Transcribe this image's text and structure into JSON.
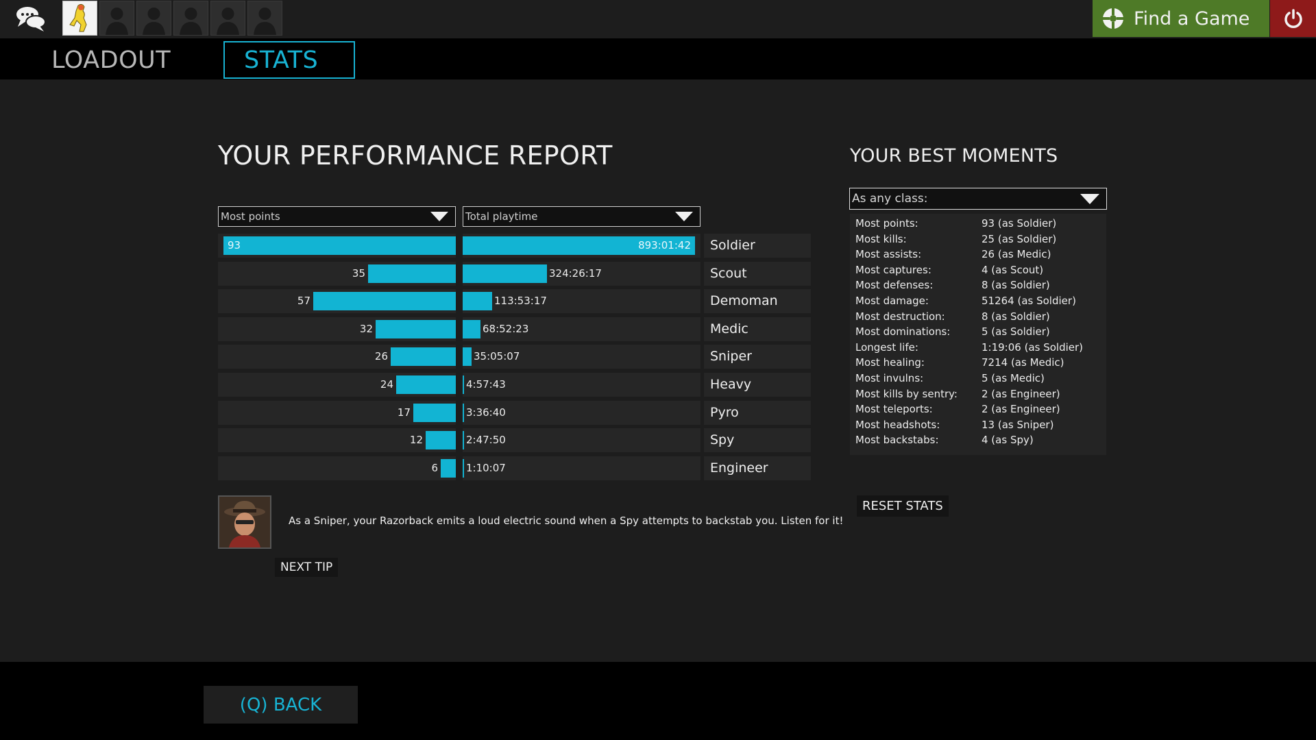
{
  "topbar": {
    "find_game_label": "Find a Game"
  },
  "tabs": [
    {
      "label": "LOADOUT"
    },
    {
      "label": "STATS"
    }
  ],
  "report": {
    "title": "YOUR PERFORMANCE REPORT",
    "left_dropdown": "Most points",
    "right_dropdown": "Total playtime",
    "rows": [
      {
        "class": "Soldier",
        "points": "93",
        "playtime": "893:01:42",
        "points_value": 93,
        "playtime_hours": 893.03
      },
      {
        "class": "Scout",
        "points": "35",
        "playtime": "324:26:17",
        "points_value": 35,
        "playtime_hours": 324.44
      },
      {
        "class": "Demoman",
        "points": "57",
        "playtime": "113:53:17",
        "points_value": 57,
        "playtime_hours": 113.89
      },
      {
        "class": "Medic",
        "points": "32",
        "playtime": "68:52:23",
        "points_value": 32,
        "playtime_hours": 68.87
      },
      {
        "class": "Sniper",
        "points": "26",
        "playtime": "35:05:07",
        "points_value": 26,
        "playtime_hours": 35.09
      },
      {
        "class": "Heavy",
        "points": "24",
        "playtime": "4:57:43",
        "points_value": 24,
        "playtime_hours": 4.96
      },
      {
        "class": "Pyro",
        "points": "17",
        "playtime": "3:36:40",
        "points_value": 17,
        "playtime_hours": 3.61
      },
      {
        "class": "Spy",
        "points": "12",
        "playtime": "2:47:50",
        "points_value": 12,
        "playtime_hours": 2.8
      },
      {
        "class": "Engineer",
        "points": "6",
        "playtime": "1:10:07",
        "points_value": 6,
        "playtime_hours": 1.17
      }
    ],
    "points_max": 93,
    "playtime_max_hours": 893.03
  },
  "tip": {
    "text": "As a Sniper, your Razorback emits a loud electric sound when a Spy attempts to backstab you. Listen for it!",
    "next_label": "NEXT TIP"
  },
  "best": {
    "title": "YOUR BEST MOMENTS",
    "dropdown": "As any class:",
    "items": [
      {
        "label": "Most points:",
        "value": "93 (as Soldier)"
      },
      {
        "label": "Most kills:",
        "value": "25 (as Soldier)"
      },
      {
        "label": "Most assists:",
        "value": "26 (as Medic)"
      },
      {
        "label": "Most captures:",
        "value": "4 (as Scout)"
      },
      {
        "label": "Most defenses:",
        "value": "8 (as Soldier)"
      },
      {
        "label": "Most damage:",
        "value": "51264 (as Soldier)"
      },
      {
        "label": "Most destruction:",
        "value": "8 (as Soldier)"
      },
      {
        "label": "Most dominations:",
        "value": "5 (as Soldier)"
      },
      {
        "label": "Longest life:",
        "value": "1:19:06 (as Soldier)"
      },
      {
        "label": "Most healing:",
        "value": "7214 (as Medic)"
      },
      {
        "label": "Most invulns:",
        "value": "5 (as Medic)"
      },
      {
        "label": "Most kills by sentry:",
        "value": "2 (as Engineer)"
      },
      {
        "label": "Most teleports:",
        "value": "2 (as Engineer)"
      },
      {
        "label": "Most headshots:",
        "value": "13 (as Sniper)"
      },
      {
        "label": "Most backstabs:",
        "value": "4 (as Spy)"
      }
    ],
    "reset_label": "RESET STATS"
  },
  "footer": {
    "back_label": "(Q) BACK"
  },
  "colors": {
    "accent": "#12b4d3",
    "find_game": "#4e7a27",
    "power": "#8e1a1a"
  }
}
